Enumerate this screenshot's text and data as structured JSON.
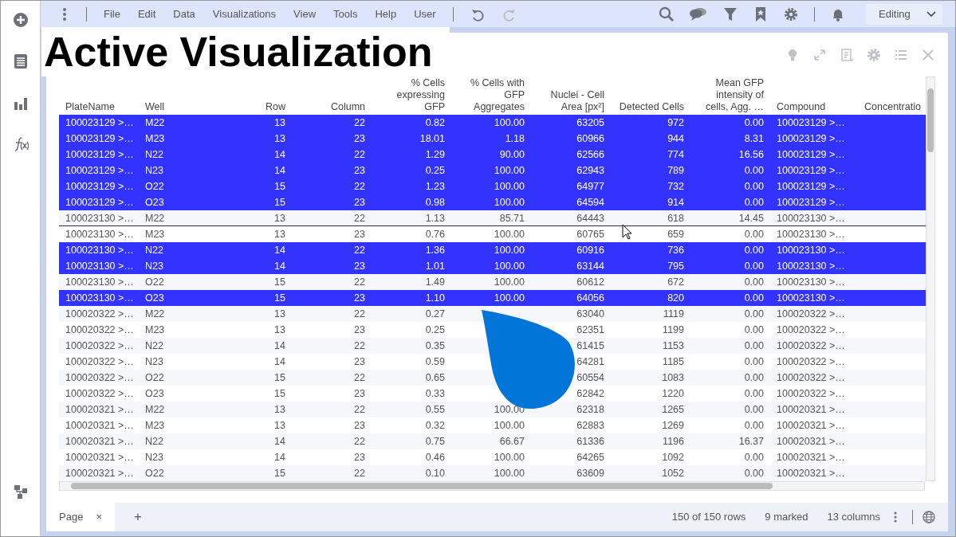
{
  "toolbar": {
    "menus": [
      "File",
      "Edit",
      "Data",
      "Visualizations",
      "View",
      "Tools",
      "Help",
      "User"
    ],
    "undo": {
      "disabled": false
    },
    "redo": {
      "disabled": true
    },
    "mode": "Editing"
  },
  "overlay_title": "Active Visualization",
  "table": {
    "columns": [
      {
        "lines": [
          "PlateName"
        ],
        "kind": "text"
      },
      {
        "lines": [
          "Well"
        ],
        "kind": "text"
      },
      {
        "lines": [
          "Row"
        ],
        "kind": "number"
      },
      {
        "lines": [
          "Column"
        ],
        "kind": "number"
      },
      {
        "lines": [
          "% Cells",
          "expressing",
          "GFP"
        ],
        "kind": "number"
      },
      {
        "lines": [
          "% Cells with",
          "GFP",
          "Aggregates"
        ],
        "kind": "number"
      },
      {
        "lines": [
          "Nuclei - Cell",
          "Area [px²]"
        ],
        "kind": "number"
      },
      {
        "lines": [
          "Detected Cells"
        ],
        "kind": "number"
      },
      {
        "lines": [
          "Mean GFP",
          "intensity of",
          "cells, Agg. …"
        ],
        "kind": "number"
      },
      {
        "lines": [
          "Compound"
        ],
        "kind": "text"
      },
      {
        "lines": [
          "Concentratio"
        ],
        "kind": "text"
      }
    ],
    "rows": [
      {
        "selected": true,
        "current": false,
        "cells": [
          "100023129 >…",
          "M22",
          "13",
          "22",
          "0.82",
          "100.00",
          "63205",
          "972",
          "0.00",
          "100023129 >…"
        ]
      },
      {
        "selected": true,
        "current": false,
        "cells": [
          "100023129 >…",
          "M23",
          "13",
          "23",
          "18.01",
          "1.18",
          "60966",
          "944",
          "8.31",
          "100023129 >…"
        ]
      },
      {
        "selected": true,
        "current": false,
        "cells": [
          "100023129 >…",
          "N22",
          "14",
          "22",
          "1.29",
          "90.00",
          "62566",
          "774",
          "16.56",
          "100023129 >…"
        ]
      },
      {
        "selected": true,
        "current": false,
        "cells": [
          "100023129 >…",
          "N23",
          "14",
          "23",
          "0.25",
          "100.00",
          "62943",
          "789",
          "0.00",
          "100023129 >…"
        ]
      },
      {
        "selected": true,
        "current": false,
        "cells": [
          "100023129 >…",
          "O22",
          "15",
          "22",
          "1.23",
          "100.00",
          "64977",
          "732",
          "0.00",
          "100023129 >…"
        ]
      },
      {
        "selected": true,
        "current": false,
        "cells": [
          "100023129 >…",
          "O23",
          "15",
          "23",
          "0.98",
          "100.00",
          "64594",
          "914",
          "0.00",
          "100023129 >…"
        ]
      },
      {
        "selected": false,
        "current": true,
        "cells": [
          "100023130 >…",
          "M22",
          "13",
          "22",
          "1.13",
          "85.71",
          "64443",
          "618",
          "14.45",
          "100023130 >…"
        ]
      },
      {
        "selected": false,
        "current": false,
        "cells": [
          "100023130 >…",
          "M23",
          "13",
          "23",
          "0.76",
          "100.00",
          "60765",
          "659",
          "0.00",
          "100023130 >…"
        ]
      },
      {
        "selected": true,
        "current": false,
        "cells": [
          "100023130 >…",
          "N22",
          "14",
          "22",
          "1.36",
          "100.00",
          "60916",
          "736",
          "0.00",
          "100023130 >…"
        ]
      },
      {
        "selected": true,
        "current": false,
        "cells": [
          "100023130 >…",
          "N23",
          "14",
          "23",
          "1.01",
          "100.00",
          "63144",
          "795",
          "0.00",
          "100023130 >…"
        ]
      },
      {
        "selected": false,
        "current": false,
        "cells": [
          "100023130 >…",
          "O22",
          "15",
          "22",
          "1.49",
          "100.00",
          "60612",
          "672",
          "0.00",
          "100023130 >…"
        ]
      },
      {
        "selected": true,
        "current": false,
        "cells": [
          "100023130 >…",
          "O23",
          "15",
          "23",
          "1.10",
          "100.00",
          "64056",
          "820",
          "0.00",
          "100023130 >…"
        ]
      },
      {
        "selected": false,
        "current": false,
        "cells": [
          "100020322 >…",
          "M22",
          "13",
          "22",
          "0.27",
          null,
          "63040",
          "1119",
          "0.00",
          "100020322 >…"
        ]
      },
      {
        "selected": false,
        "current": false,
        "cells": [
          "100020322 >…",
          "M23",
          "13",
          "23",
          "0.25",
          null,
          "62351",
          "1199",
          "0.00",
          "100020322 >…"
        ]
      },
      {
        "selected": false,
        "current": false,
        "cells": [
          "100020322 >…",
          "N22",
          "14",
          "22",
          "0.35",
          null,
          "61415",
          "1153",
          "0.00",
          "100020322 >…"
        ]
      },
      {
        "selected": false,
        "current": false,
        "cells": [
          "100020322 >…",
          "N23",
          "14",
          "23",
          "0.59",
          null,
          "64281",
          "1185",
          "0.00",
          "100020322 >…"
        ]
      },
      {
        "selected": false,
        "current": false,
        "cells": [
          "100020322 >…",
          "O22",
          "15",
          "22",
          "0.65",
          null,
          "60554",
          "1083",
          "0.00",
          "100020322 >…"
        ]
      },
      {
        "selected": false,
        "current": false,
        "cells": [
          "100020322 >…",
          "O23",
          "15",
          "23",
          "0.33",
          null,
          "62842",
          "1220",
          "0.00",
          "100020322 >…"
        ]
      },
      {
        "selected": false,
        "current": false,
        "cells": [
          "100020321 >…",
          "M22",
          "13",
          "22",
          "0.55",
          "100.00",
          "62318",
          "1265",
          "0.00",
          "100020321 >…"
        ]
      },
      {
        "selected": false,
        "current": false,
        "cells": [
          "100020321 >…",
          "M23",
          "13",
          "23",
          "0.32",
          "100.00",
          "62883",
          "1269",
          "0.00",
          "100020321 >…"
        ]
      },
      {
        "selected": false,
        "current": false,
        "cells": [
          "100020321 >…",
          "N22",
          "14",
          "22",
          "0.75",
          "66.67",
          "61336",
          "1196",
          "16.37",
          "100020321 >…"
        ]
      },
      {
        "selected": false,
        "current": false,
        "cells": [
          "100020321 >…",
          "N23",
          "14",
          "23",
          "0.46",
          "100.00",
          "64265",
          "1092",
          "0.00",
          "100020321 >…"
        ]
      },
      {
        "selected": false,
        "current": false,
        "cells": [
          "100020321 >…",
          "O22",
          "15",
          "22",
          "0.10",
          "100.00",
          "63609",
          "1052",
          "0.00",
          "100020321 >…"
        ]
      }
    ]
  },
  "status_bar": {
    "tab": "Page",
    "tab_close": "×",
    "add": "+",
    "rows": "150 of 150 rows",
    "marked": "9 marked",
    "columns": "13 columns"
  }
}
